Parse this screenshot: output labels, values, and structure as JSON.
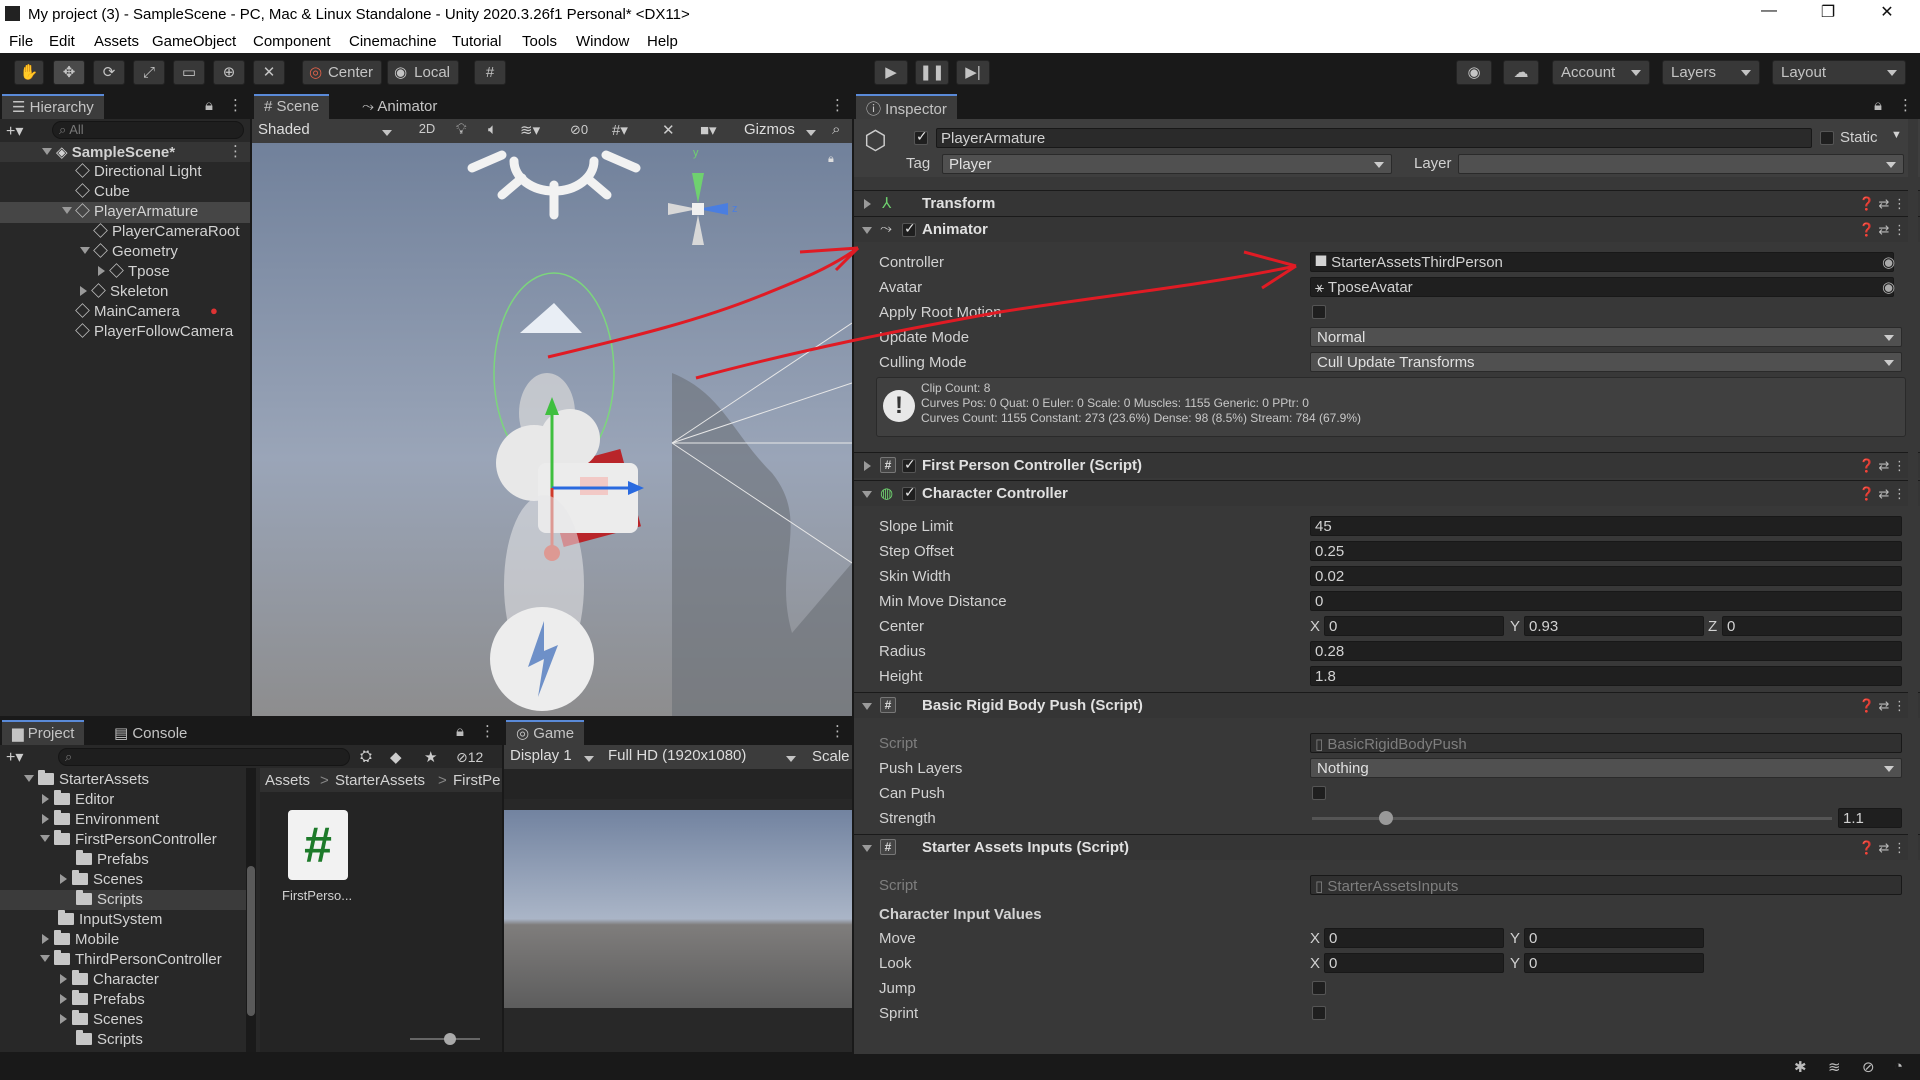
{
  "window": {
    "title": "My project (3) - SampleScene - PC, Mac & Linux Standalone - Unity 2020.3.26f1 Personal* <DX11>",
    "minimize": "—",
    "maximize": "❐",
    "close": "✕"
  },
  "menu": [
    "File",
    "Edit",
    "Assets",
    "GameObject",
    "Component",
    "Cinemachine",
    "Tutorial",
    "Tools",
    "Window",
    "Help"
  ],
  "toolbar": {
    "pivot": "Center",
    "space": "Local",
    "account": "Account",
    "layers": "Layers",
    "layout": "Layout"
  },
  "hierarchy": {
    "tab": "Hierarchy",
    "search_placeholder": "All",
    "items": [
      "SampleScene*",
      "Directional Light",
      "Cube",
      "PlayerArmature",
      "PlayerCameraRoot",
      "Geometry",
      "Tpose",
      "Skeleton",
      "MainCamera",
      "PlayerFollowCamera"
    ]
  },
  "scene": {
    "tabs": [
      "Scene",
      "Animator"
    ],
    "shading": "Shaded",
    "mode_2d": "2D",
    "hidden_count": "0",
    "gizmos": "Gizmos",
    "axes": {
      "y": "y",
      "z": "z"
    }
  },
  "project": {
    "tabs": [
      "Project",
      "Console"
    ],
    "hidden_count": "12",
    "tree": [
      "StarterAssets",
      "Editor",
      "Environment",
      "FirstPersonController",
      "Prefabs",
      "Scenes",
      "Scripts",
      "InputSystem",
      "Mobile",
      "ThirdPersonController",
      "Character",
      "Prefabs",
      "Scenes",
      "Scripts"
    ],
    "breadcrumb": [
      "Assets",
      "StarterAssets",
      "FirstPe"
    ],
    "asset_label": "FirstPerso..."
  },
  "game": {
    "tab": "Game",
    "display": "Display 1",
    "resolution": "Full HD (1920x1080)",
    "scale": "Scale"
  },
  "inspector": {
    "tab": "Inspector",
    "object_name": "PlayerArmature",
    "static": "Static",
    "tag_label": "Tag",
    "tag_value": "Player",
    "layer_label": "Layer",
    "layer_value": "",
    "transform": "Transform",
    "animator": {
      "title": "Animator",
      "controller_label": "Controller",
      "controller_value": "StarterAssetsThirdPerson",
      "avatar_label": "Avatar",
      "avatar_value": "TposeAvatar",
      "root_motion_label": "Apply Root Motion",
      "update_label": "Update Mode",
      "update_value": "Normal",
      "culling_label": "Culling Mode",
      "culling_value": "Cull Update Transforms",
      "info_1": "Clip Count: 8",
      "info_2": "Curves Pos: 0 Quat: 0 Euler: 0 Scale: 0 Muscles: 1155 Generic: 0 PPtr: 0",
      "info_3": "Curves Count: 1155 Constant: 273 (23.6%) Dense: 98 (8.5%) Stream: 784 (67.9%)"
    },
    "fpc": "First Person Controller (Script)",
    "cc": {
      "title": "Character Controller",
      "slope_label": "Slope Limit",
      "slope": "45",
      "step_label": "Step Offset",
      "step": "0.25",
      "skin_label": "Skin Width",
      "skin": "0.02",
      "minmove_label": "Min Move Distance",
      "minmove": "0",
      "center_label": "Center",
      "cx": "0",
      "cy": "0.93",
      "cz": "0",
      "radius_label": "Radius",
      "radius": "0.28",
      "height_label": "Height",
      "height": "1.8"
    },
    "push": {
      "title": "Basic Rigid Body Push (Script)",
      "script_label": "Script",
      "script": "BasicRigidBodyPush",
      "layers_label": "Push Layers",
      "layers": "Nothing",
      "canpush_label": "Can Push",
      "strength_label": "Strength",
      "strength": "1.1"
    },
    "inputs": {
      "title": "Starter Assets Inputs (Script)",
      "script_label": "Script",
      "script": "StarterAssetsInputs",
      "section": "Character Input Values",
      "move_label": "Move",
      "move_x": "0",
      "move_y": "0",
      "look_label": "Look",
      "look_x": "0",
      "look_y": "0",
      "jump_label": "Jump",
      "sprint_label": "Sprint"
    },
    "axis": {
      "x": "X",
      "y": "Y",
      "z": "Z"
    }
  },
  "colors": {
    "accent": "#5a8ad8",
    "annotation": "#e01b24"
  }
}
